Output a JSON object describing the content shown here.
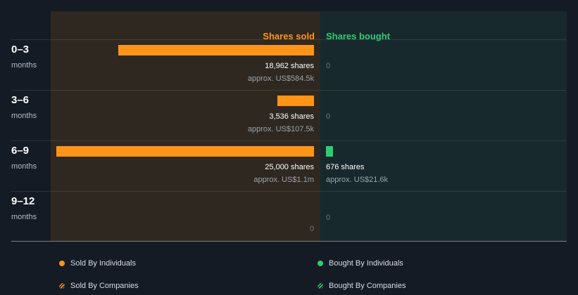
{
  "colors": {
    "background": "#151b24",
    "sold": "#ff9518",
    "bought": "#2ecc71",
    "sold_panel": "#2e2820",
    "bought_panel": "#17292c"
  },
  "headers": {
    "sold": "Shares sold",
    "bought": "Shares bought"
  },
  "chart_data": {
    "type": "bar",
    "categories": [
      "0–3",
      "3–6",
      "6–9",
      "9–12"
    ],
    "category_unit": "months",
    "series": [
      {
        "name": "Shares sold",
        "values": [
          18962,
          3536,
          25000,
          0
        ],
        "shares_labels": [
          "18,962 shares",
          "3,536 shares",
          "25,000 shares",
          "0"
        ],
        "value_labels": [
          "approx. US$584.5k",
          "approx. US$107.5k",
          "approx. US$1.1m",
          ""
        ]
      },
      {
        "name": "Shares bought",
        "values": [
          0,
          0,
          676,
          0
        ],
        "shares_labels": [
          "0",
          "0",
          "676 shares",
          "0"
        ],
        "value_labels": [
          "",
          "",
          "approx. US$21.6k",
          ""
        ]
      }
    ]
  },
  "legend": [
    {
      "label": "Sold By Individuals",
      "icon": "orange-dot-icon"
    },
    {
      "label": "Bought By Individuals",
      "icon": "green-dot-icon"
    },
    {
      "label": "Sold By Companies",
      "icon": "orange-hatched-dot-icon"
    },
    {
      "label": "Bought By Companies",
      "icon": "green-hatched-dot-icon"
    }
  ]
}
